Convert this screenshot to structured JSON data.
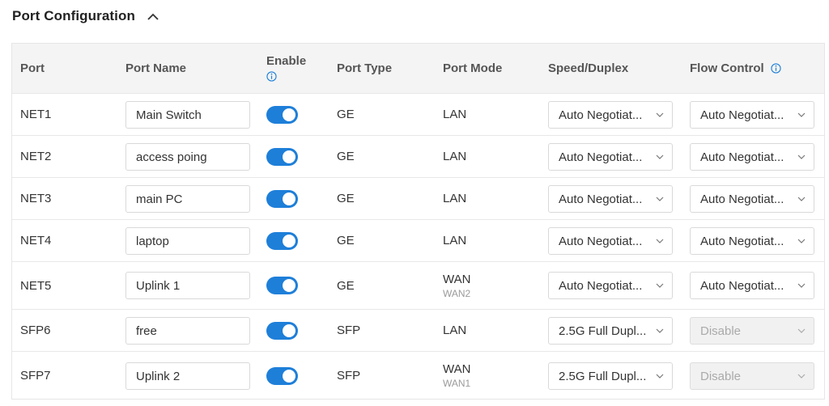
{
  "section": {
    "title": "Port Configuration",
    "collapse_icon": "chevron-up-icon"
  },
  "columns": {
    "port": "Port",
    "port_name": "Port Name",
    "enable": "Enable",
    "port_type": "Port Type",
    "port_mode": "Port Mode",
    "speed_duplex": "Speed/Duplex",
    "flow_control": "Flow Control"
  },
  "colors": {
    "accent": "#1e7fd9",
    "header_bg": "#f4f4f4",
    "disabled_bg": "#f1f1f1"
  },
  "rows": [
    {
      "port": "NET1",
      "name": "Main Switch",
      "enabled": true,
      "type": "GE",
      "mode": "LAN",
      "mode_sub": "",
      "speed": "Auto Negotiat...",
      "flow": "Auto Negotiat...",
      "flow_disabled": false
    },
    {
      "port": "NET2",
      "name": "access poing",
      "enabled": true,
      "type": "GE",
      "mode": "LAN",
      "mode_sub": "",
      "speed": "Auto Negotiat...",
      "flow": "Auto Negotiat...",
      "flow_disabled": false
    },
    {
      "port": "NET3",
      "name": "main PC",
      "enabled": true,
      "type": "GE",
      "mode": "LAN",
      "mode_sub": "",
      "speed": "Auto Negotiat...",
      "flow": "Auto Negotiat...",
      "flow_disabled": false
    },
    {
      "port": "NET4",
      "name": "laptop",
      "enabled": true,
      "type": "GE",
      "mode": "LAN",
      "mode_sub": "",
      "speed": "Auto Negotiat...",
      "flow": "Auto Negotiat...",
      "flow_disabled": false
    },
    {
      "port": "NET5",
      "name": "Uplink 1",
      "enabled": true,
      "type": "GE",
      "mode": "WAN",
      "mode_sub": "WAN2",
      "speed": "Auto Negotiat...",
      "flow": "Auto Negotiat...",
      "flow_disabled": false
    },
    {
      "port": "SFP6",
      "name": "free",
      "enabled": true,
      "type": "SFP",
      "mode": "LAN",
      "mode_sub": "",
      "speed": "2.5G Full Dupl...",
      "flow": "Disable",
      "flow_disabled": true
    },
    {
      "port": "SFP7",
      "name": "Uplink 2",
      "enabled": true,
      "type": "SFP",
      "mode": "WAN",
      "mode_sub": "WAN1",
      "speed": "2.5G Full Dupl...",
      "flow": "Disable",
      "flow_disabled": true
    }
  ]
}
